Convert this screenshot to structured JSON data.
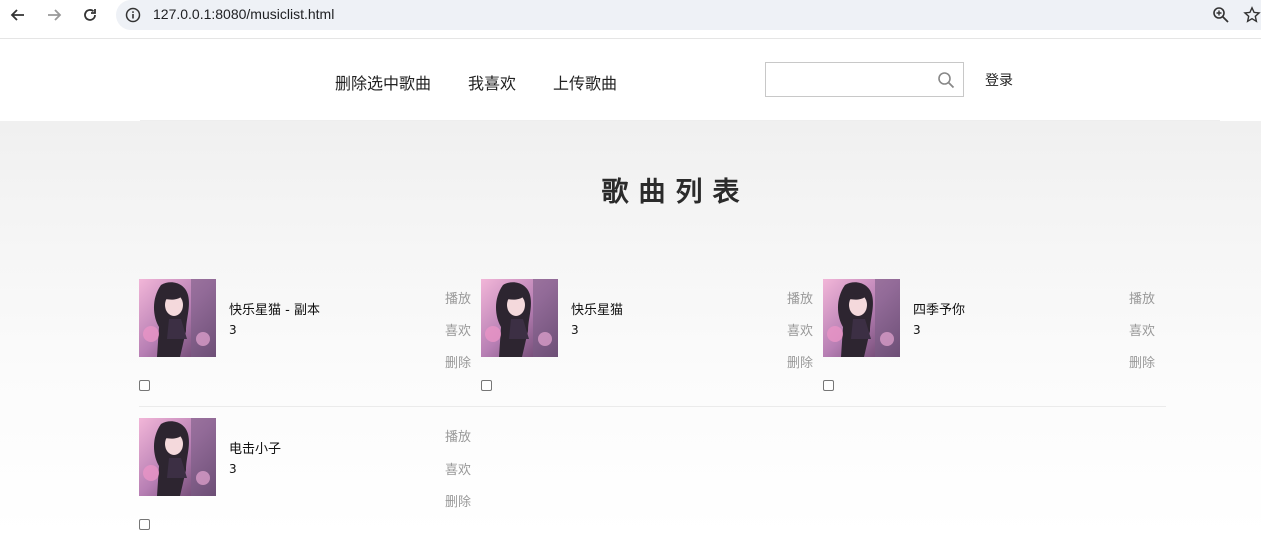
{
  "browser": {
    "url": "127.0.0.1:8080/musiclist.html"
  },
  "header": {
    "nav": [
      "删除选中歌曲",
      "我喜欢",
      "上传歌曲"
    ],
    "search_placeholder": "",
    "login": "登录"
  },
  "page": {
    "title": "歌曲列表"
  },
  "songs": [
    {
      "name": "快乐星猫 - 副本",
      "count": "3",
      "actions": [
        "播放",
        "喜欢",
        "删除"
      ]
    },
    {
      "name": "快乐星猫",
      "count": "3",
      "actions": [
        "播放",
        "喜欢",
        "删除"
      ]
    },
    {
      "name": "四季予你",
      "count": "3",
      "actions": [
        "播放",
        "喜欢",
        "删除"
      ]
    },
    {
      "name": "电击小子",
      "count": "3",
      "actions": [
        "播放",
        "喜欢",
        "删除"
      ]
    }
  ],
  "colors": {
    "action_text": "#999999",
    "title_text": "#2b2b2b"
  }
}
